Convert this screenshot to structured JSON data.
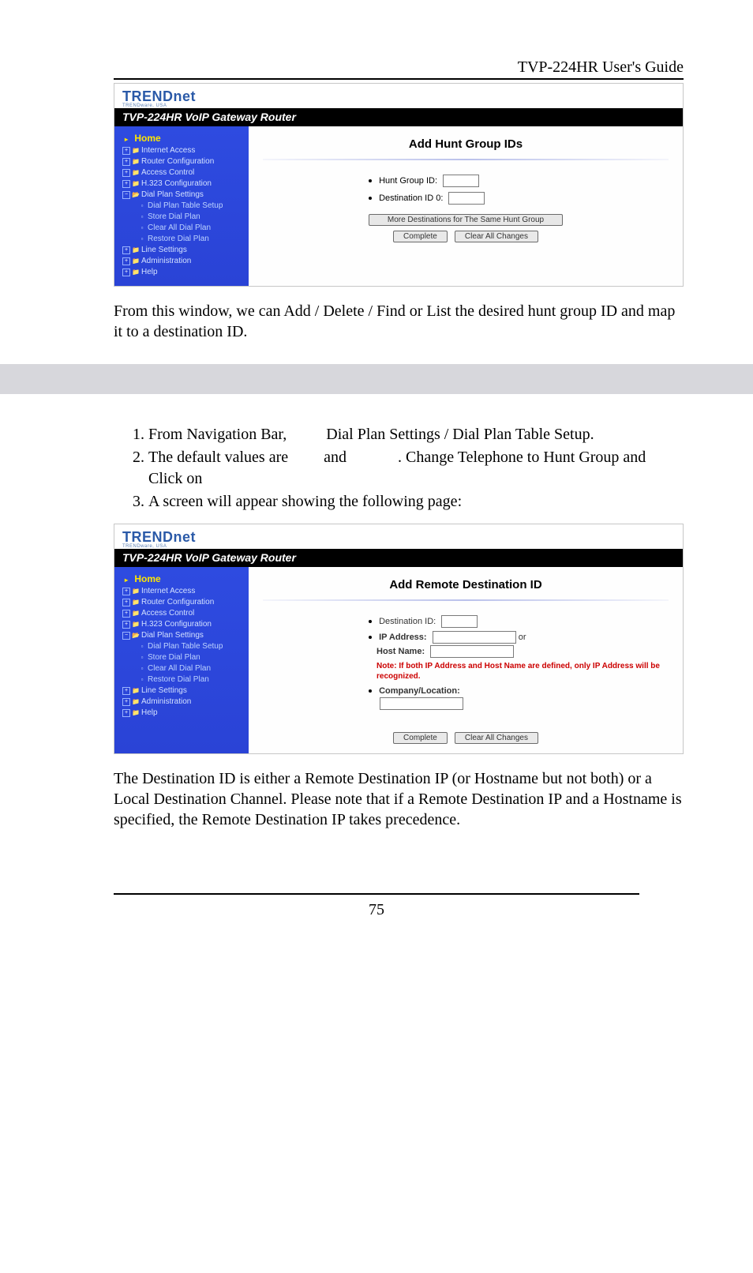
{
  "header": {
    "title": "TVP-224HR User's Guide"
  },
  "router1": {
    "logo_text": "TRENDnet",
    "logo_tag": "TRENDware, USA",
    "blackbar": "TVP-224HR VoIP Gateway Router",
    "sidebar": {
      "home": "Home",
      "items": [
        "Internet Access",
        "Router Configuration",
        "Access Control",
        "H.323 Configuration",
        "Dial Plan Settings"
      ],
      "subitems": [
        "Dial Plan Table Setup",
        "Store Dial Plan",
        "Clear All Dial Plan",
        "Restore Dial Plan"
      ],
      "tail": [
        "Line Settings",
        "Administration",
        "Help"
      ]
    },
    "main": {
      "title": "Add Hunt Group IDs",
      "row1_label": "Hunt Group ID:",
      "row2_label": "Destination ID 0:",
      "widebtn": "More Destinations for The Same Hunt Group",
      "btn_complete": "Complete",
      "btn_clear": "Clear All Changes"
    }
  },
  "para1": "From this window, we can Add / Delete / Find or List the desired hunt group ID and map it to a destination ID.",
  "steps": [
    {
      "pre": "From Navigation Bar,",
      "mid": "Dial Plan Settings / Dial Plan Table Setup."
    },
    {
      "pre": "The default values are",
      "mid": "and",
      "post": ". Change Telephone to Hunt Group and Click on"
    },
    {
      "pre": "A screen will appear showing the following page:"
    }
  ],
  "router2": {
    "logo_text": "TRENDnet",
    "logo_tag": "TRENDware, USA",
    "blackbar": "TVP-224HR VoIP Gateway Router",
    "sidebar": {
      "home": "Home",
      "items": [
        "Internet Access",
        "Router Configuration",
        "Access Control",
        "H.323 Configuration",
        "Dial Plan Settings"
      ],
      "subitems": [
        "Dial Plan Table Setup",
        "Store Dial Plan",
        "Clear All Dial Plan",
        "Restore Dial Plan"
      ],
      "tail": [
        "Line Settings",
        "Administration",
        "Help"
      ]
    },
    "main": {
      "title": "Add Remote Destination ID",
      "dest_label": "Destination ID:",
      "ip_label": "IP Address:",
      "or_text": "or",
      "host_label": "Host Name:",
      "note": "Note: If both IP Address and Host Name are defined, only IP Address will be recognized.",
      "company_label": "Company/Location:",
      "btn_complete": "Complete",
      "btn_clear": "Clear All Changes"
    }
  },
  "para2": "The Destination ID is either a Remote Destination IP (or Hostname but not both) or a Local Destination Channel. Please note that if a Remote Destination IP and a Hostname is specified, the Remote Destination IP takes precedence.",
  "pagenum": "75"
}
